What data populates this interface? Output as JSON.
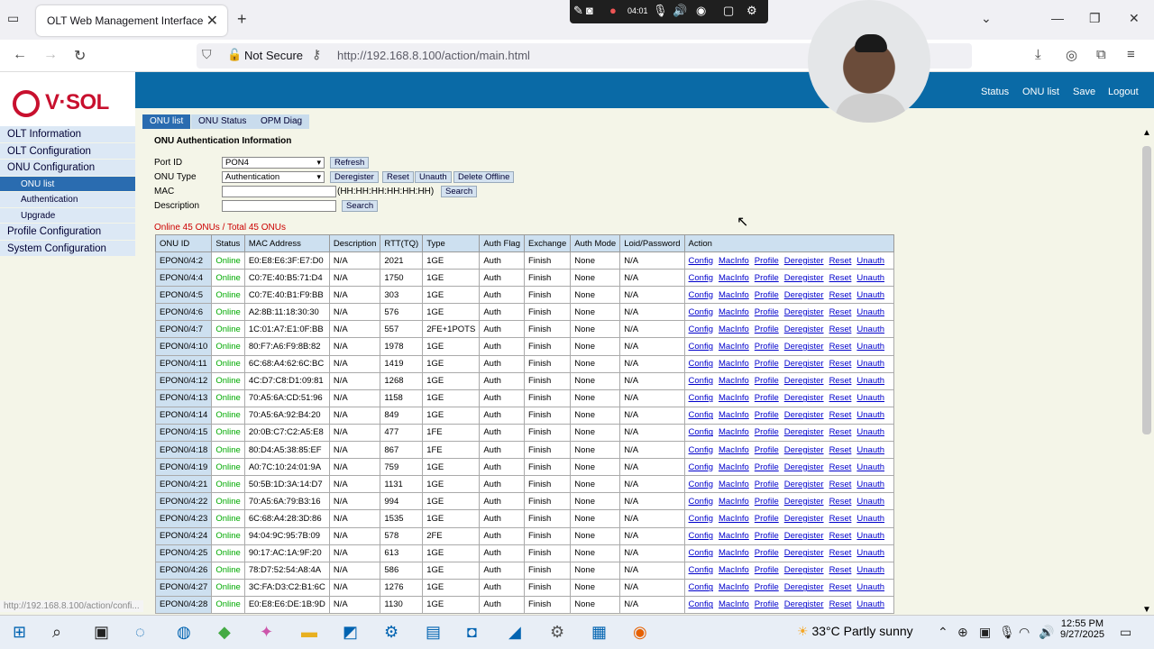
{
  "browser": {
    "tab_title": "OLT Web Management Interface",
    "security_label": "Not Secure",
    "url": "http://192.168.8.100/action/main.html",
    "status_url": "http://192.168.8.100/action/confi..."
  },
  "recorder": {
    "time": "04:01"
  },
  "app": {
    "logo": "V·SOL",
    "header_links": [
      "Status",
      "ONU list",
      "Save",
      "Logout"
    ],
    "sidebar": {
      "items": [
        "OLT Information",
        "OLT Configuration",
        "ONU Configuration"
      ],
      "sub_items": [
        "ONU list",
        "Authentication",
        "Upgrade"
      ],
      "items_after": [
        "Profile Configuration",
        "System Configuration"
      ]
    },
    "tabs": [
      "ONU list",
      "ONU Status",
      "OPM Diag"
    ],
    "section_title": "ONU Authentication Information",
    "form": {
      "port_id_label": "Port ID",
      "port_id_value": "PON4",
      "onu_type_label": "ONU Type",
      "onu_type_value": "Authentication",
      "mac_label": "MAC",
      "mac_hint": "(HH:HH:HH:HH:HH:HH)",
      "description_label": "Description",
      "refresh": "Refresh",
      "deregister": "Deregister",
      "reset": "Reset",
      "unauth": "Unauth",
      "delete_offline": "Delete Offline",
      "search": "Search"
    },
    "summary": "Online 45 ONUs / Total 45 ONUs",
    "columns": [
      "ONU ID",
      "Status",
      "MAC Address",
      "Description",
      "RTT(TQ)",
      "Type",
      "Auth Flag",
      "Exchange",
      "Auth Mode",
      "Loid/Password",
      "Action"
    ],
    "actions": [
      "Config",
      "MacInfo",
      "Profile",
      "Deregister",
      "Reset",
      "Unauth"
    ],
    "rows": [
      [
        "EPON0/4:2",
        "Online",
        "E0:E8:E6:3F:E7:D0",
        "N/A",
        "2021",
        "1GE",
        "Auth",
        "Finish",
        "None",
        "N/A"
      ],
      [
        "EPON0/4:4",
        "Online",
        "C0:7E:40:B5:71:D4",
        "N/A",
        "1750",
        "1GE",
        "Auth",
        "Finish",
        "None",
        "N/A"
      ],
      [
        "EPON0/4:5",
        "Online",
        "C0:7E:40:B1:F9:BB",
        "N/A",
        "303",
        "1GE",
        "Auth",
        "Finish",
        "None",
        "N/A"
      ],
      [
        "EPON0/4:6",
        "Online",
        "A2:8B:11:18:30:30",
        "N/A",
        "576",
        "1GE",
        "Auth",
        "Finish",
        "None",
        "N/A"
      ],
      [
        "EPON0/4:7",
        "Online",
        "1C:01:A7:E1:0F:BB",
        "N/A",
        "557",
        "2FE+1POTS",
        "Auth",
        "Finish",
        "None",
        "N/A"
      ],
      [
        "EPON0/4:10",
        "Online",
        "80:F7:A6:F9:8B:82",
        "N/A",
        "1978",
        "1GE",
        "Auth",
        "Finish",
        "None",
        "N/A"
      ],
      [
        "EPON0/4:11",
        "Online",
        "6C:68:A4:62:6C:BC",
        "N/A",
        "1419",
        "1GE",
        "Auth",
        "Finish",
        "None",
        "N/A"
      ],
      [
        "EPON0/4:12",
        "Online",
        "4C:D7:C8:D1:09:81",
        "N/A",
        "1268",
        "1GE",
        "Auth",
        "Finish",
        "None",
        "N/A"
      ],
      [
        "EPON0/4:13",
        "Online",
        "70:A5:6A:CD:51:96",
        "N/A",
        "1158",
        "1GE",
        "Auth",
        "Finish",
        "None",
        "N/A"
      ],
      [
        "EPON0/4:14",
        "Online",
        "70:A5:6A:92:B4:20",
        "N/A",
        "849",
        "1GE",
        "Auth",
        "Finish",
        "None",
        "N/A"
      ],
      [
        "EPON0/4:15",
        "Online",
        "20:0B:C7:C2:A5:E8",
        "N/A",
        "477",
        "1FE",
        "Auth",
        "Finish",
        "None",
        "N/A"
      ],
      [
        "EPON0/4:18",
        "Online",
        "80:D4:A5:38:85:EF",
        "N/A",
        "867",
        "1FE",
        "Auth",
        "Finish",
        "None",
        "N/A"
      ],
      [
        "EPON0/4:19",
        "Online",
        "A0:7C:10:24:01:9A",
        "N/A",
        "759",
        "1GE",
        "Auth",
        "Finish",
        "None",
        "N/A"
      ],
      [
        "EPON0/4:21",
        "Online",
        "50:5B:1D:3A:14:D7",
        "N/A",
        "1131",
        "1GE",
        "Auth",
        "Finish",
        "None",
        "N/A"
      ],
      [
        "EPON0/4:22",
        "Online",
        "70:A5:6A:79:B3:16",
        "N/A",
        "994",
        "1GE",
        "Auth",
        "Finish",
        "None",
        "N/A"
      ],
      [
        "EPON0/4:23",
        "Online",
        "6C:68:A4:28:3D:86",
        "N/A",
        "1535",
        "1GE",
        "Auth",
        "Finish",
        "None",
        "N/A"
      ],
      [
        "EPON0/4:24",
        "Online",
        "94:04:9C:95:7B:09",
        "N/A",
        "578",
        "2FE",
        "Auth",
        "Finish",
        "None",
        "N/A"
      ],
      [
        "EPON0/4:25",
        "Online",
        "90:17:AC:1A:9F:20",
        "N/A",
        "613",
        "1GE",
        "Auth",
        "Finish",
        "None",
        "N/A"
      ],
      [
        "EPON0/4:26",
        "Online",
        "78:D7:52:54:A8:4A",
        "N/A",
        "586",
        "1GE",
        "Auth",
        "Finish",
        "None",
        "N/A"
      ],
      [
        "EPON0/4:27",
        "Online",
        "3C:FA:D3:C2:B1:6C",
        "N/A",
        "1276",
        "1GE",
        "Auth",
        "Finish",
        "None",
        "N/A"
      ],
      [
        "EPON0/4:28",
        "Online",
        "E0:E8:E6:DE:1B:9D",
        "N/A",
        "1130",
        "1GE",
        "Auth",
        "Finish",
        "None",
        "N/A"
      ]
    ]
  },
  "taskbar": {
    "temperature": "33°C",
    "weather": "Partly sunny",
    "time": "12:55 PM",
    "date": "9/27/2025"
  },
  "colors": {
    "header": "#0a6aa6",
    "accent": "#2a6cb0",
    "online": "#00aa00",
    "summary": "#cc0000"
  }
}
